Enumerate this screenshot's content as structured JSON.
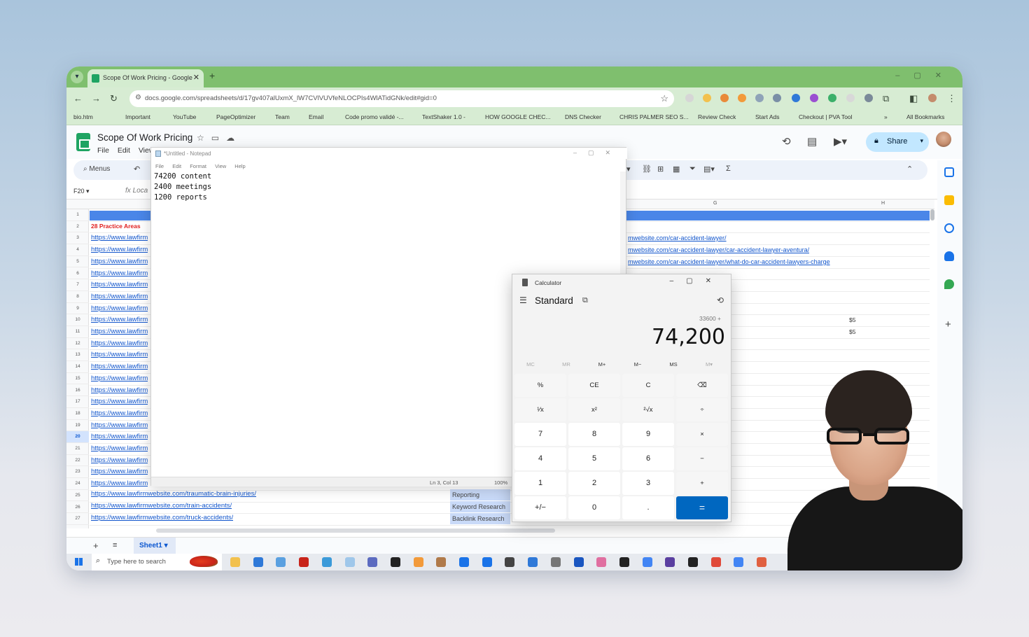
{
  "browser": {
    "tab_title": "Scope Of Work Pricing - Google",
    "url": "docs.google.com/spreadsheets/d/17gv407alUxmX_lW7CVlVUVfeNLOCPIs4WlATidGNk/edit#gid=0",
    "bookmarks": [
      "bio.htm",
      "Important",
      "YouTube",
      "PageOptimizer",
      "Team",
      "Email",
      "Code promo validé -...",
      "TextShaker 1.0 -",
      "HOW GOOGLE CHEC...",
      "DNS Checker",
      "CHRIS PALMER SEO S...",
      "Review Check",
      "Start Ads",
      "Checkout | PVA Tool"
    ],
    "all_bookmarks": "All Bookmarks"
  },
  "sheets": {
    "doc_title": "Scope Of Work Pricing",
    "menus": [
      "File",
      "Edit",
      "View"
    ],
    "menus_search": "Menus",
    "share_label": "Share",
    "name_box": "F20",
    "formula_value": "Loca",
    "col_g": "G",
    "col_h": "H",
    "row_numbers": [
      "1",
      "2",
      "3",
      "4",
      "5",
      "6",
      "7",
      "8",
      "9",
      "10",
      "11",
      "12",
      "13",
      "14",
      "15",
      "16",
      "17",
      "18",
      "19",
      "20",
      "21",
      "22",
      "23",
      "24",
      "25",
      "26",
      "27"
    ],
    "practice_areas": "28 Practice Areas",
    "link_stub": "https://www.lawfirm",
    "links_full": [
      "https://www.lawfirmwebsite.com/traumatic-brain-injuries/",
      "https://www.lawfirmwebsite.com/train-accidents/",
      "https://www.lawfirmwebsite.com/truck-accidents/"
    ],
    "links_right": [
      "mwebsite.com/car-accident-lawyer/",
      "mwebsite.com/car-accident-lawyer/car-accident-lawyer-aventura/",
      "mwebsite.com/car-accident-lawyer/what-do-car-accident-lawyers-charge"
    ],
    "dollar_values": [
      "$5",
      "$5"
    ],
    "task_cells": [
      "Reporting",
      "Keyword Research",
      "Backlink Research"
    ],
    "sheet_tab": "Sheet1"
  },
  "notepad": {
    "title": "*Untitled - Notepad",
    "menu": [
      "File",
      "Edit",
      "Format",
      "View",
      "Help"
    ],
    "lines": [
      "74200 content",
      "2400 meetings",
      "1200 reports"
    ],
    "status_position": "Ln 3, Col 13",
    "status_zoom": "100%"
  },
  "calculator": {
    "title": "Calculator",
    "mode": "Standard",
    "expression": "33600 +",
    "display": "74,200",
    "memory": [
      "MC",
      "MR",
      "M+",
      "M−",
      "MS",
      "M▾"
    ],
    "buttons": [
      [
        "%",
        "CE",
        "C",
        "⌫"
      ],
      [
        "¹⁄x",
        "x²",
        "²√x",
        "÷"
      ],
      [
        "7",
        "8",
        "9",
        "×"
      ],
      [
        "4",
        "5",
        "6",
        "−"
      ],
      [
        "1",
        "2",
        "3",
        "+"
      ],
      [
        "+/−",
        "0",
        ".",
        "="
      ]
    ]
  },
  "taskbar": {
    "search_placeholder": "Type here to search"
  }
}
